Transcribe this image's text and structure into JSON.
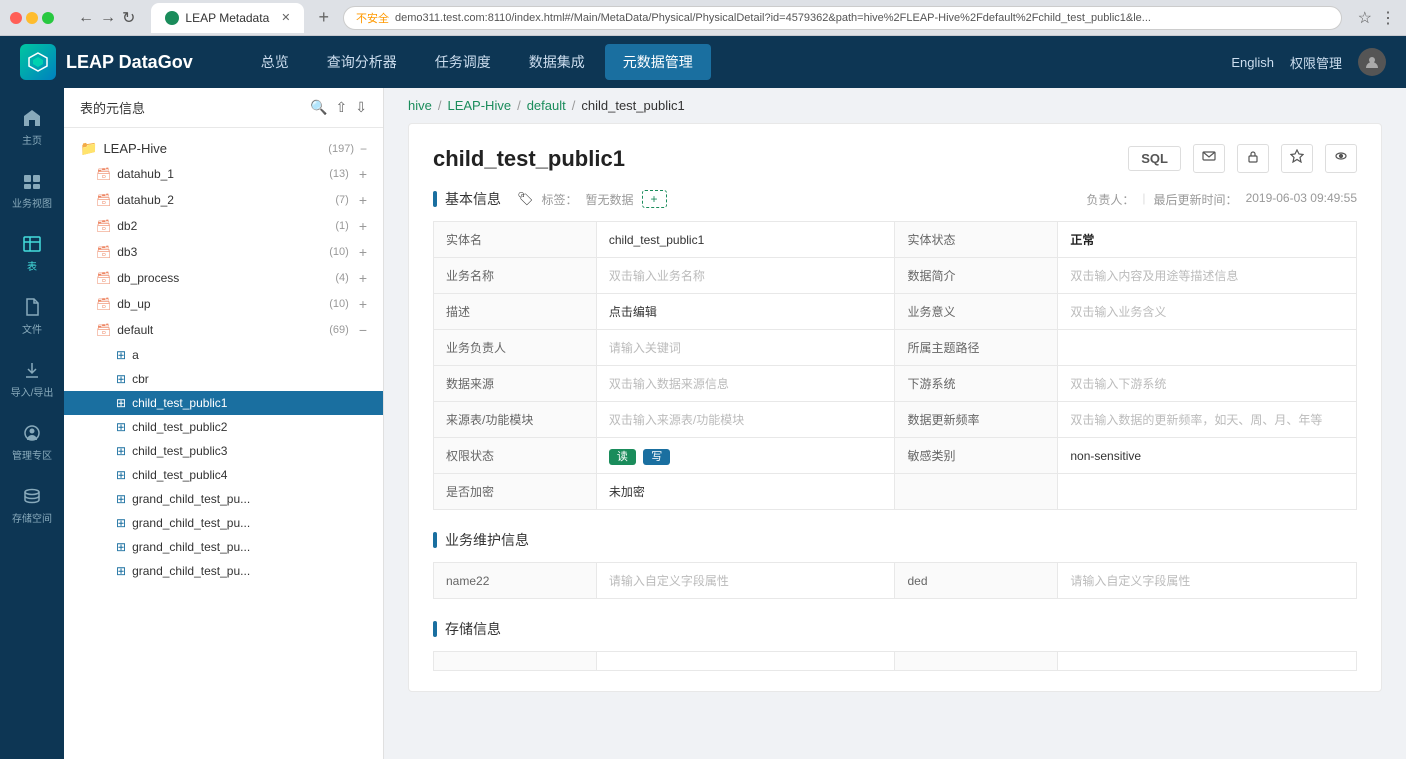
{
  "browser": {
    "tab_title": "LEAP Metadata",
    "url": "demo311.test.com:8110/index.html#/Main/MetaData/Physical/PhysicalDetail?id=4579362&path=hive%2FLEAP-Hive%2Fdefault%2Fchild_test_public1&le...",
    "url_security": "不安全"
  },
  "nav": {
    "logo_text": "LEAP DataGov",
    "items": [
      "总览",
      "查询分析器",
      "任务调度",
      "数据集成",
      "元数据管理"
    ],
    "active_item": "元数据管理",
    "right_lang": "English",
    "right_admin": "权限管理"
  },
  "sidebar_icons": [
    {
      "id": "home",
      "label": "主页",
      "icon": "home"
    },
    {
      "id": "business",
      "label": "业务视图",
      "icon": "business"
    },
    {
      "id": "table",
      "label": "表",
      "icon": "table",
      "active": true
    },
    {
      "id": "file",
      "label": "文件",
      "icon": "file"
    },
    {
      "id": "import",
      "label": "导入/导出",
      "icon": "import"
    },
    {
      "id": "admin",
      "label": "管理专区",
      "icon": "admin"
    },
    {
      "id": "storage",
      "label": "存储空间",
      "icon": "storage"
    }
  ],
  "left_panel": {
    "title": "表的元信息",
    "tree_root": {
      "label": "LEAP-Hive",
      "count": "197"
    },
    "tree_items": [
      {
        "label": "datahub_1",
        "count": "13"
      },
      {
        "label": "datahub_2",
        "count": "7"
      },
      {
        "label": "db2",
        "count": "1"
      },
      {
        "label": "db3",
        "count": "10"
      },
      {
        "label": "db_process",
        "count": "4"
      },
      {
        "label": "db_up",
        "count": "10"
      },
      {
        "label": "default",
        "count": "69",
        "expanded": true
      }
    ],
    "table_items": [
      {
        "label": "a"
      },
      {
        "label": "cbr"
      },
      {
        "label": "child_test_public1",
        "active": true
      },
      {
        "label": "child_test_public2"
      },
      {
        "label": "child_test_public3"
      },
      {
        "label": "child_test_public4"
      },
      {
        "label": "grand_child_test_pu..."
      },
      {
        "label": "grand_child_test_pu..."
      },
      {
        "label": "grand_child_test_pu..."
      },
      {
        "label": "grand_child_test_pu..."
      }
    ]
  },
  "breadcrumb": {
    "items": [
      "hive",
      "LEAP-Hive",
      "default",
      "child_test_public1"
    ]
  },
  "detail": {
    "title": "child_test_public1",
    "actions": {
      "sql": "SQL",
      "email": "✉",
      "lock": "🔒",
      "star": "★",
      "eye": "👁"
    },
    "basic_info": {
      "section_title": "基本信息",
      "tags_label": "标签：",
      "tags_no_data": "暂无数据",
      "tag_add": "+",
      "owner_label": "负责人：",
      "last_update_label": "最后更新时间：",
      "last_update_value": "2019-06-03 09:49:55",
      "fields": [
        {
          "label": "实体名",
          "value": "child_test_public1",
          "is_placeholder": false,
          "col": 1
        },
        {
          "label": "实体状态",
          "value": "正常",
          "is_placeholder": false,
          "col": 2
        },
        {
          "label": "业务名称",
          "value": "双击输入业务名称",
          "is_placeholder": true,
          "col": 1
        },
        {
          "label": "数据简介",
          "value": "双击输入内容及用途等描述信息",
          "is_placeholder": true,
          "col": 2
        },
        {
          "label": "描述",
          "value": "点击编辑",
          "is_placeholder": false,
          "col": 1
        },
        {
          "label": "业务意义",
          "value": "双击输入业务含义",
          "is_placeholder": true,
          "col": 2
        },
        {
          "label": "业务负责人",
          "value": "请输入关键词",
          "is_placeholder": true,
          "col": 1
        },
        {
          "label": "所属主题路径",
          "value": "",
          "is_placeholder": false,
          "col": 2
        },
        {
          "label": "数据来源",
          "value": "双击输入数据来源信息",
          "is_placeholder": true,
          "col": 1
        },
        {
          "label": "下游系统",
          "value": "双击输入下游系统",
          "is_placeholder": true,
          "col": 2
        },
        {
          "label": "来源表/功能模块",
          "value": "双击输入来源表/功能模块",
          "is_placeholder": true,
          "col": 1
        },
        {
          "label": "数据更新频率",
          "value": "双击输入数据的更新频率，如天、周、月、年等",
          "is_placeholder": true,
          "col": 2
        },
        {
          "label": "权限状态",
          "value": "",
          "is_placeholder": false,
          "col": 1
        },
        {
          "label": "敏感类别",
          "value": "non-sensitive",
          "is_placeholder": false,
          "col": 2
        },
        {
          "label": "是否加密",
          "value": "未加密",
          "is_placeholder": false,
          "col": 1
        }
      ],
      "permissions_read": "读",
      "permissions_write": "写"
    },
    "maintenance": {
      "section_title": "业务维护信息",
      "fields": [
        {
          "label": "name22",
          "value": "请输入自定义字段属性",
          "is_placeholder": true,
          "col": 1
        },
        {
          "label": "ded",
          "value": "请输入自定义字段属性",
          "is_placeholder": true,
          "col": 2
        }
      ]
    },
    "storage": {
      "section_title": "存储信息"
    }
  }
}
